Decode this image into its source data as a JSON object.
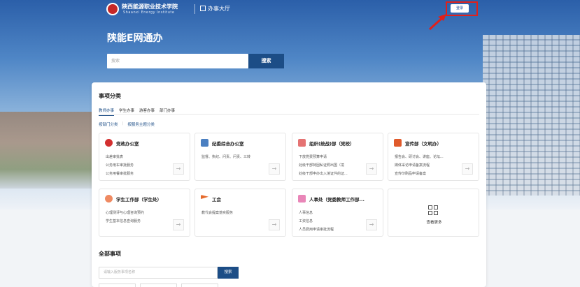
{
  "header": {
    "school_name_cn": "陕西能源职业技术学院",
    "school_name_en": "Shaanxi Energy Institute",
    "section": "办事大厅",
    "login_label": "登录"
  },
  "hero": {
    "title": "陕能E网通办",
    "search_placeholder": "搜索",
    "search_button": "搜索"
  },
  "categories": {
    "title": "事项分类",
    "tabs": [
      {
        "label": "教师办事",
        "active": true
      },
      {
        "label": "学生办事",
        "active": false
      },
      {
        "label": "游客办事",
        "active": false
      },
      {
        "label": "部门办事",
        "active": false
      }
    ],
    "subtabs": [
      "按部门分类",
      "按服务主题分类"
    ]
  },
  "cards": [
    {
      "title": "党政办公室",
      "icon": "party-emblem-icon",
      "color": "#d32f2f",
      "items": [
        "出差审批表",
        "公务用车审批服务",
        "公务用餐审批服务"
      ]
    },
    {
      "title": "纪委综合办公室",
      "icon": "monitor-icon",
      "color": "#4a7fc1",
      "items": [
        "监督、执纪、问责、问责、三转"
      ]
    },
    {
      "title": "组织(统战)部（党校）",
      "icon": "document-icon",
      "color": "#e57373",
      "items": [
        "下放党费预算申请",
        "处级干部特因私证照出国（境",
        "处级干部申办出入境证件的证..."
      ]
    },
    {
      "title": "宣传部（文明办）",
      "icon": "briefcase-icon",
      "color": "#e05a2b",
      "items": [
        "报告会、研讨会、讲座、论坛...",
        "媒体采访申请备案流程",
        "宣传印刷品申请备案"
      ]
    },
    {
      "title": "学生工作部（学生处）",
      "icon": "student-icon",
      "color": "#ef8a62",
      "items": [
        "心理测评与心理咨询预约",
        "学生基本信息查询服务"
      ]
    },
    {
      "title": "工会",
      "icon": "flag-icon",
      "color": "#e5692b",
      "items": [
        "教代会提案落实服务"
      ]
    },
    {
      "title": "人事处（党委教师工作部...",
      "icon": "personnel-icon",
      "color": "#e986b8",
      "items": [
        "人事信息",
        "工资信息",
        "人员费用申请审批流程"
      ]
    }
  ],
  "more": {
    "label": "查看更多"
  },
  "all_items": {
    "title": "全部事项",
    "search_placeholder": "请输入服务事项名称",
    "search_button": "搜索"
  }
}
